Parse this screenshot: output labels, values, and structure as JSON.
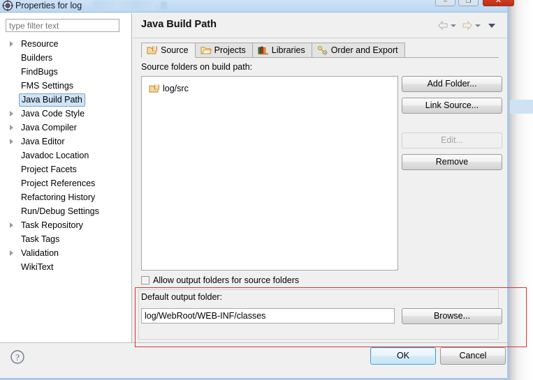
{
  "window": {
    "title": "Properties for log",
    "title_icon": "properties-gear-icon",
    "controls": {
      "minimize": "–",
      "maximize": "❐",
      "close": "✕"
    }
  },
  "sidebar": {
    "filter": {
      "value": "",
      "placeholder": "type filter text"
    },
    "items": [
      {
        "label": "Resource",
        "expandable": true,
        "selected": false
      },
      {
        "label": "Builders",
        "expandable": false,
        "selected": false
      },
      {
        "label": "FindBugs",
        "expandable": false,
        "selected": false
      },
      {
        "label": "FMS Settings",
        "expandable": false,
        "selected": false
      },
      {
        "label": "Java Build Path",
        "expandable": false,
        "selected": true
      },
      {
        "label": "Java Code Style",
        "expandable": true,
        "selected": false
      },
      {
        "label": "Java Compiler",
        "expandable": true,
        "selected": false
      },
      {
        "label": "Java Editor",
        "expandable": true,
        "selected": false
      },
      {
        "label": "Javadoc Location",
        "expandable": false,
        "selected": false
      },
      {
        "label": "Project Facets",
        "expandable": false,
        "selected": false
      },
      {
        "label": "Project References",
        "expandable": false,
        "selected": false
      },
      {
        "label": "Refactoring History",
        "expandable": false,
        "selected": false
      },
      {
        "label": "Run/Debug Settings",
        "expandable": false,
        "selected": false
      },
      {
        "label": "Task Repository",
        "expandable": true,
        "selected": false
      },
      {
        "label": "Task Tags",
        "expandable": false,
        "selected": false
      },
      {
        "label": "Validation",
        "expandable": true,
        "selected": false
      },
      {
        "label": "WikiText",
        "expandable": false,
        "selected": false
      }
    ]
  },
  "page": {
    "title": "Java Build Path",
    "nav": {
      "back_icon": "arrow-left-icon",
      "back_menu_icon": "chevron-down-icon",
      "forward_icon": "arrow-right-icon",
      "forward_menu_icon": "chevron-down-icon",
      "menu_icon": "chevron-down-icon"
    },
    "tabs": [
      {
        "label": "Source",
        "icon": "source-folder-icon",
        "active": true
      },
      {
        "label": "Projects",
        "icon": "open-folder-icon",
        "active": false
      },
      {
        "label": "Libraries",
        "icon": "books-icon",
        "active": false
      },
      {
        "label": "Order and Export",
        "icon": "order-export-icon",
        "active": false
      }
    ],
    "source": {
      "list_label": "Source folders on build path:",
      "entries": [
        {
          "label": "log/src",
          "icon": "source-folder-icon"
        }
      ],
      "buttons": [
        {
          "label": "Add Folder...",
          "enabled": true
        },
        {
          "label": "Link Source...",
          "enabled": true
        },
        {
          "label": "Edit...",
          "enabled": false
        },
        {
          "label": "Remove",
          "enabled": true
        }
      ],
      "allow_output_folders": {
        "label": "Allow output folders for source folders",
        "checked": false
      },
      "default_output": {
        "label": "Default output folder:",
        "value": "log/WebRoot/WEB-INF/classes",
        "browse_label": "Browse..."
      }
    }
  },
  "footer": {
    "help_icon": "help-question-icon",
    "ok_label": "OK",
    "cancel_label": "Cancel"
  },
  "annotation": {
    "highlight_color": "#e03030"
  }
}
